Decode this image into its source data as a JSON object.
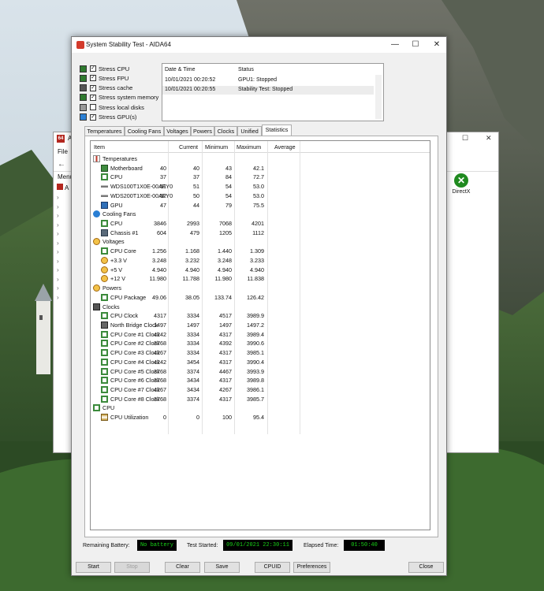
{
  "background_window": {
    "title_prefix": "A",
    "logo_text": "64",
    "menu_file": "File",
    "menu_label": "Menu",
    "tree_root": "A",
    "directx_label": "DirectX",
    "window_controls": {
      "minimize": "–",
      "maximize": "☐",
      "close": "✕"
    }
  },
  "window": {
    "title": "System Stability Test - AIDA64",
    "controls": {
      "minimize": "—",
      "maximize": "☐",
      "close": "✕"
    }
  },
  "stress_options": [
    {
      "label": "Stress CPU",
      "checked": true,
      "icon": "cpu-chip-icon"
    },
    {
      "label": "Stress FPU",
      "checked": true,
      "icon": "fpu-chip-icon"
    },
    {
      "label": "Stress cache",
      "checked": true,
      "icon": "cache-icon"
    },
    {
      "label": "Stress system memory",
      "checked": true,
      "icon": "memory-icon"
    },
    {
      "label": "Stress local disks",
      "checked": false,
      "icon": "disk-icon"
    },
    {
      "label": "Stress GPU(s)",
      "checked": true,
      "icon": "monitor-icon"
    }
  ],
  "log": {
    "headers": {
      "datetime": "Date & Time",
      "status": "Status"
    },
    "rows": [
      {
        "datetime": "10/01/2021 00:20:52",
        "status": "GPU1: Stopped"
      },
      {
        "datetime": "10/01/2021 00:20:55",
        "status": "Stability Test: Stopped"
      }
    ]
  },
  "tabs": [
    "Temperatures",
    "Cooling Fans",
    "Voltages",
    "Powers",
    "Clocks",
    "Unified",
    "Statistics"
  ],
  "active_tab": "Statistics",
  "stats": {
    "headers": {
      "item": "Item",
      "current": "Current",
      "minimum": "Minimum",
      "maximum": "Maximum",
      "average": "Average"
    },
    "rows": [
      {
        "type": "group",
        "label": "Temperatures",
        "icon": "thermometer-icon"
      },
      {
        "type": "item",
        "label": "Motherboard",
        "icon": "motherboard-icon",
        "cur": "40",
        "min": "40",
        "max": "43",
        "avg": "42.1"
      },
      {
        "type": "item",
        "label": "CPU",
        "icon": "cpu-icon",
        "cur": "37",
        "min": "37",
        "max": "84",
        "avg": "72.7"
      },
      {
        "type": "item",
        "label": "WDS100T1X0E-00AFY0",
        "icon": "drive-icon",
        "cur": "51",
        "min": "51",
        "max": "54",
        "avg": "53.0"
      },
      {
        "type": "item",
        "label": "WDS200T1X0E-00AFY0",
        "icon": "drive-icon",
        "cur": "52",
        "min": "50",
        "max": "54",
        "avg": "53.0"
      },
      {
        "type": "item",
        "label": "GPU",
        "icon": "gpu-icon",
        "cur": "47",
        "min": "44",
        "max": "79",
        "avg": "75.5"
      },
      {
        "type": "group",
        "label": "Cooling Fans",
        "icon": "fan-icon"
      },
      {
        "type": "item",
        "label": "CPU",
        "icon": "cpu-icon",
        "cur": "3846",
        "min": "2993",
        "max": "7068",
        "avg": "4201"
      },
      {
        "type": "item",
        "label": "Chassis #1",
        "icon": "chassis-icon",
        "cur": "604",
        "min": "479",
        "max": "1205",
        "avg": "1112"
      },
      {
        "type": "group",
        "label": "Voltages",
        "icon": "voltage-icon"
      },
      {
        "type": "item",
        "label": "CPU Core",
        "icon": "cpu-icon",
        "cur": "1.256",
        "min": "1.168",
        "max": "1.440",
        "avg": "1.309"
      },
      {
        "type": "item",
        "label": "+3.3 V",
        "icon": "voltage-icon",
        "cur": "3.248",
        "min": "3.232",
        "max": "3.248",
        "avg": "3.233"
      },
      {
        "type": "item",
        "label": "+5 V",
        "icon": "voltage-icon",
        "cur": "4.940",
        "min": "4.940",
        "max": "4.940",
        "avg": "4.940"
      },
      {
        "type": "item",
        "label": "+12 V",
        "icon": "voltage-icon",
        "cur": "11.980",
        "min": "11.788",
        "max": "11.980",
        "avg": "11.838"
      },
      {
        "type": "group",
        "label": "Powers",
        "icon": "power-icon"
      },
      {
        "type": "item",
        "label": "CPU Package",
        "icon": "cpu-icon",
        "cur": "49.06",
        "min": "38.05",
        "max": "133.74",
        "avg": "126.42"
      },
      {
        "type": "group",
        "label": "Clocks",
        "icon": "clock-icon"
      },
      {
        "type": "item",
        "label": "CPU Clock",
        "icon": "cpu-icon",
        "cur": "4317",
        "min": "3334",
        "max": "4517",
        "avg": "3989.9"
      },
      {
        "type": "item",
        "label": "North Bridge Clock",
        "icon": "northbridge-icon",
        "cur": "1497",
        "min": "1497",
        "max": "1497",
        "avg": "1497.2"
      },
      {
        "type": "item",
        "label": "CPU Core #1 Clock",
        "icon": "cpu-icon",
        "cur": "4242",
        "min": "3334",
        "max": "4317",
        "avg": "3989.4"
      },
      {
        "type": "item",
        "label": "CPU Core #2 Clock",
        "icon": "cpu-icon",
        "cur": "3768",
        "min": "3334",
        "max": "4392",
        "avg": "3990.6"
      },
      {
        "type": "item",
        "label": "CPU Core #3 Clock",
        "icon": "cpu-icon",
        "cur": "4267",
        "min": "3334",
        "max": "4317",
        "avg": "3985.1"
      },
      {
        "type": "item",
        "label": "CPU Core #4 Clock",
        "icon": "cpu-icon",
        "cur": "4242",
        "min": "3454",
        "max": "4317",
        "avg": "3990.4"
      },
      {
        "type": "item",
        "label": "CPU Core #5 Clock",
        "icon": "cpu-icon",
        "cur": "3768",
        "min": "3374",
        "max": "4467",
        "avg": "3993.9"
      },
      {
        "type": "item",
        "label": "CPU Core #6 Clock",
        "icon": "cpu-icon",
        "cur": "3768",
        "min": "3434",
        "max": "4317",
        "avg": "3989.8"
      },
      {
        "type": "item",
        "label": "CPU Core #7 Clock",
        "icon": "cpu-icon",
        "cur": "4267",
        "min": "3434",
        "max": "4267",
        "avg": "3986.1"
      },
      {
        "type": "item",
        "label": "CPU Core #8 Clock",
        "icon": "cpu-icon",
        "cur": "3768",
        "min": "3374",
        "max": "4317",
        "avg": "3985.7"
      },
      {
        "type": "group",
        "label": "CPU",
        "icon": "cpu-icon"
      },
      {
        "type": "item",
        "label": "CPU Utilization",
        "icon": "hourglass-icon",
        "cur": "0",
        "min": "0",
        "max": "100",
        "avg": "95.4"
      }
    ]
  },
  "status": {
    "battery_label": "Remaining Battery:",
    "battery_value": "No battery",
    "started_label": "Test Started:",
    "started_value": "09/01/2021 22:30:11",
    "elapsed_label": "Elapsed Time:",
    "elapsed_value": "01:50:40"
  },
  "buttons": {
    "start": "Start",
    "stop": "Stop",
    "clear": "Clear",
    "save": "Save",
    "cpuid": "CPUID",
    "preferences": "Preferences",
    "close": "Close"
  },
  "colors": {
    "led_text": "#19d419",
    "led_bg": "#000000",
    "group_icon_orange": "#d98a1a",
    "cpu_icon_green": "#3b8a3b"
  }
}
